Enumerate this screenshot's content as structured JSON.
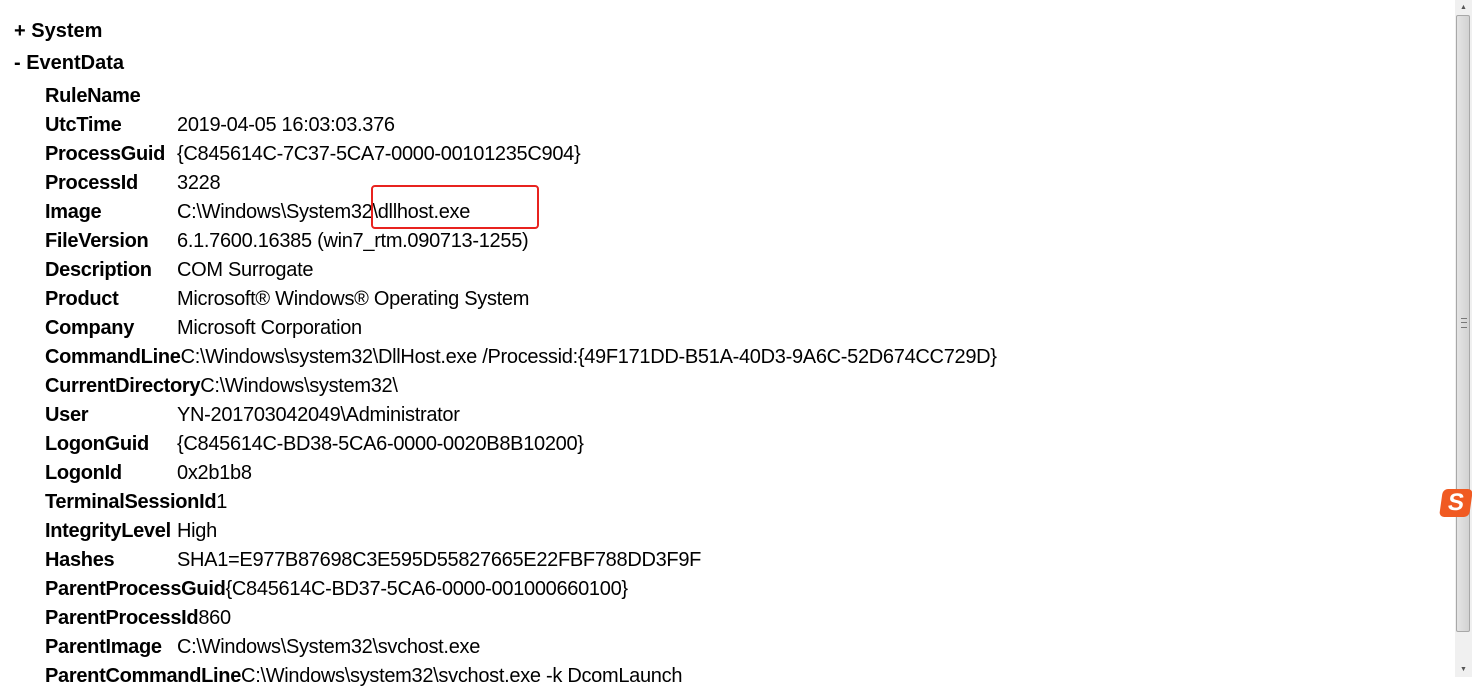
{
  "tree": {
    "system": "+ System",
    "eventdata": "-  EventData"
  },
  "fields": [
    {
      "label": "RuleName",
      "value": ""
    },
    {
      "label": "UtcTime",
      "value": "2019-04-05 16:03:03.376"
    },
    {
      "label": "ProcessGuid",
      "value": "{C845614C-7C37-5CA7-0000-00101235C904}"
    },
    {
      "label": "ProcessId",
      "value": "3228"
    },
    {
      "label": "Image",
      "value": "C:\\Windows\\System32\\dllhost.exe"
    },
    {
      "label": "FileVersion",
      "value": "6.1.7600.16385 (win7_rtm.090713-1255)"
    },
    {
      "label": "Description",
      "value": "COM Surrogate"
    },
    {
      "label": "Product",
      "value": "Microsoft® Windows® Operating System"
    },
    {
      "label": "Company",
      "value": "Microsoft Corporation"
    },
    {
      "label": "CommandLine",
      "value": "C:\\Windows\\system32\\DllHost.exe /Processid:{49F171DD-B51A-40D3-9A6C-52D674CC729D}"
    },
    {
      "label": "CurrentDirectory",
      "value": "C:\\Windows\\system32\\"
    },
    {
      "label": "User",
      "value": "YN-201703042049\\Administrator"
    },
    {
      "label": "LogonGuid",
      "value": "{C845614C-BD38-5CA6-0000-0020B8B10200}"
    },
    {
      "label": "LogonId",
      "value": "0x2b1b8"
    },
    {
      "label": "TerminalSessionId",
      "value": "1"
    },
    {
      "label": "IntegrityLevel",
      "value": "High"
    },
    {
      "label": "Hashes",
      "value": "SHA1=E977B87698C3E595D55827665E22FBF788DD3F9F"
    },
    {
      "label": "ParentProcessGuid",
      "value": "{C845614C-BD37-5CA6-0000-001000660100}"
    },
    {
      "label": "ParentProcessId",
      "value": "860"
    },
    {
      "label": "ParentImage",
      "value": "C:\\Windows\\System32\\svchost.exe"
    },
    {
      "label": "ParentCommandLine",
      "value": "C:\\Windows\\system32\\svchost.exe -k DcomLaunch"
    }
  ],
  "colors": {
    "highlight": "#e8231f",
    "sogou": "#f05a22"
  },
  "tray": {
    "sogou_icon": "S"
  }
}
